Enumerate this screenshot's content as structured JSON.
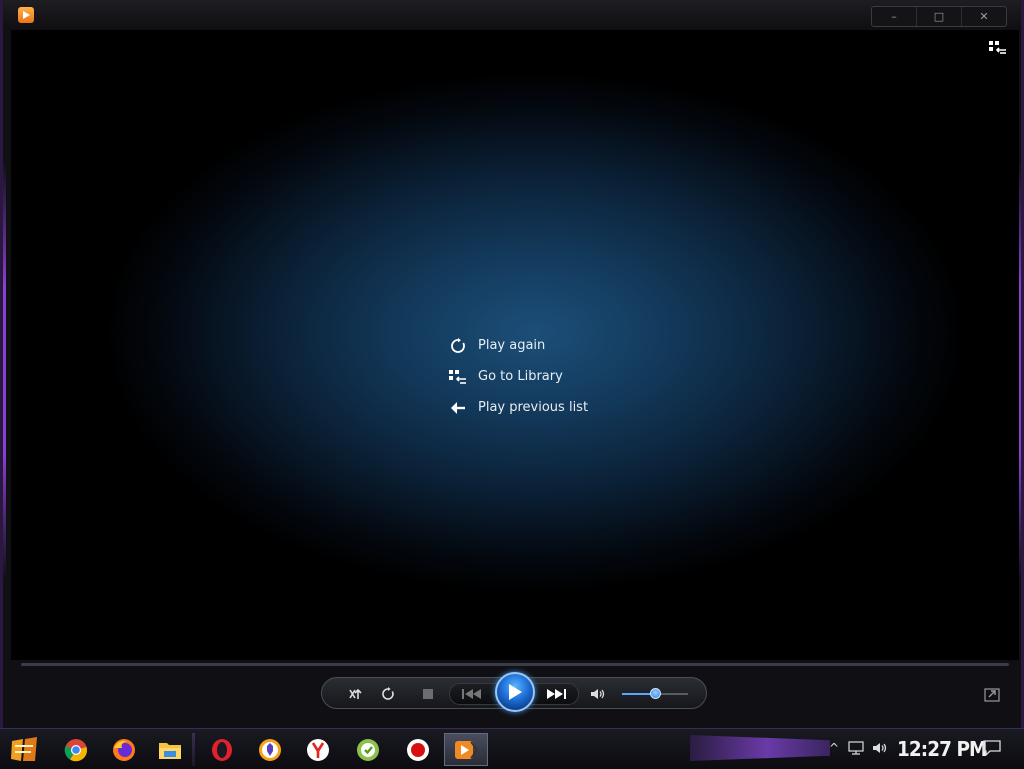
{
  "window": {
    "minimize_label": "–",
    "maximize_label": "□",
    "close_label": "✕"
  },
  "end_menu": {
    "items": [
      {
        "label": "Play again",
        "icon": "replay-icon"
      },
      {
        "label": "Go to Library",
        "icon": "library-icon"
      },
      {
        "label": "Play previous list",
        "icon": "back-arrow-icon"
      }
    ]
  },
  "controls": {
    "volume_level": 0.5,
    "accent_color": "#1d6fd6"
  },
  "taskbar": {
    "clock": "12:27 PM",
    "apps": [
      "start-icon",
      "chrome-icon",
      "firefox-icon",
      "file-explorer-icon",
      "opera-icon",
      "brave-icon",
      "yandex-icon",
      "green-app-icon",
      "record-icon",
      "media-player-icon"
    ],
    "tray_chevron": "^"
  },
  "colors": {
    "accent_purple": "#8a3fd0",
    "menu_text": "#e6eef6"
  }
}
